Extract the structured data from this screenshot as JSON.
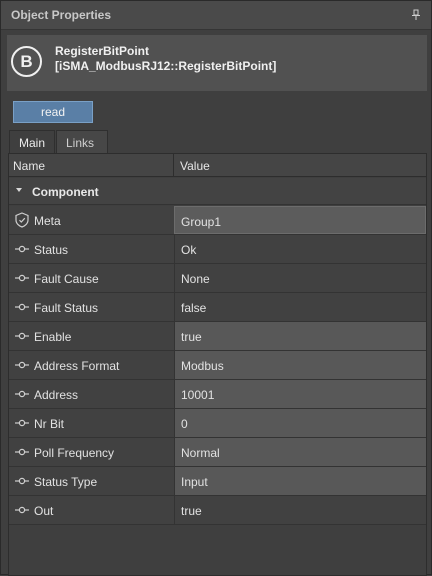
{
  "panel": {
    "title": "Object Properties",
    "pin_icon": "pin-icon"
  },
  "header": {
    "badge_letter": "B",
    "name": "RegisterBitPoint",
    "type": "[iSMA_ModbusRJ12::RegisterBitPoint]"
  },
  "actions": {
    "read_label": "read"
  },
  "tabs": [
    {
      "label": "Main",
      "active": true
    },
    {
      "label": "Links",
      "active": false
    }
  ],
  "table": {
    "col_name": "Name",
    "col_value": "Value",
    "section": "Component",
    "rows": [
      {
        "name": "Meta",
        "value": "Group1",
        "icon": "shield-icon"
      },
      {
        "name": "Status",
        "value": "Ok",
        "icon": "slot-icon"
      },
      {
        "name": "Fault Cause",
        "value": "None",
        "icon": "slot-icon"
      },
      {
        "name": "Fault Status",
        "value": "false",
        "icon": "slot-icon"
      },
      {
        "name": "Enable",
        "value": "true",
        "icon": "slot-icon"
      },
      {
        "name": "Address Format",
        "value": "Modbus",
        "icon": "slot-icon"
      },
      {
        "name": "Address",
        "value": "10001",
        "icon": "slot-icon"
      },
      {
        "name": "Nr Bit",
        "value": "0",
        "icon": "slot-icon"
      },
      {
        "name": "Poll Frequency",
        "value": "Normal",
        "icon": "slot-icon"
      },
      {
        "name": "Status Type",
        "value": "Input",
        "icon": "slot-icon"
      },
      {
        "name": "Out",
        "value": "true",
        "icon": "slot-icon"
      }
    ]
  }
}
